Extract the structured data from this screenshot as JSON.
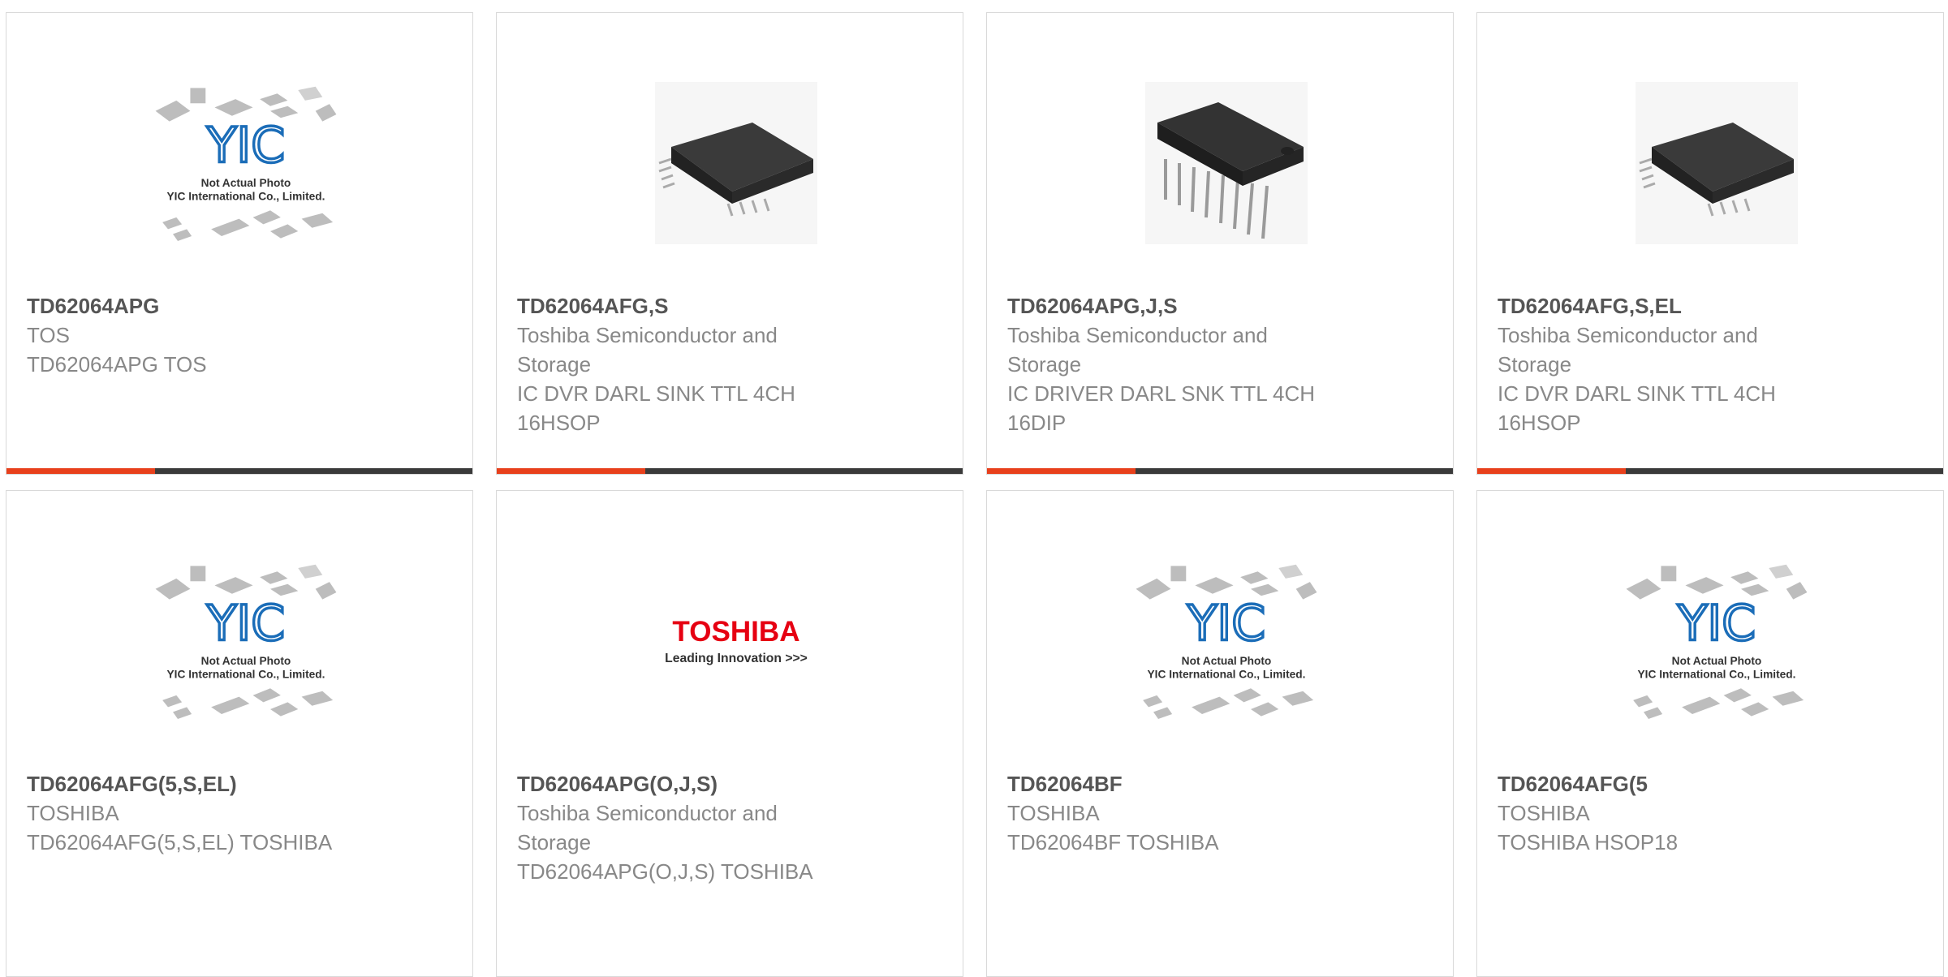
{
  "colors": {
    "accent": "#e8401c",
    "bar": "#3a3a3a",
    "yic_blue": "#1b6db8",
    "toshiba_red": "#e60012"
  },
  "placeholder": {
    "line1": "Not Actual Photo",
    "line2": "YIC International Co., Limited.",
    "logo_text": "YIC"
  },
  "toshiba_logo": {
    "brand": "TOSHIBA",
    "tagline": "Leading Innovation >>>"
  },
  "products": [
    {
      "pn": "TD62064APG",
      "lines": [
        "TOS",
        "TD62064APG TOS"
      ],
      "image": "placeholder-image"
    },
    {
      "pn": "TD62064AFG,S",
      "lines": [
        "Toshiba Semiconductor and",
        "Storage",
        "IC DVR DARL SINK TTL 4CH",
        "16HSOP"
      ],
      "image": "hsop-chip-image"
    },
    {
      "pn": "TD62064APG,J,S",
      "lines": [
        "Toshiba Semiconductor and",
        "Storage",
        "IC DRIVER DARL SNK TTL 4CH",
        "16DIP"
      ],
      "image": "dip-chip-image"
    },
    {
      "pn": "TD62064AFG,S,EL",
      "lines": [
        "Toshiba Semiconductor and",
        "Storage",
        "IC DVR DARL SINK TTL 4CH",
        "16HSOP"
      ],
      "image": "hsop-chip-image"
    },
    {
      "pn": "TD62064AFG(5,S,EL)",
      "lines": [
        "TOSHIBA",
        "TD62064AFG(5,S,EL) TOSHIBA"
      ],
      "image": "placeholder-image"
    },
    {
      "pn": "TD62064APG(O,J,S)",
      "lines": [
        "Toshiba Semiconductor and",
        "Storage",
        "TD62064APG(O,J,S) TOSHIBA"
      ],
      "image": "toshiba-logo-image"
    },
    {
      "pn": "TD62064BF",
      "lines": [
        "TOSHIBA",
        "TD62064BF TOSHIBA"
      ],
      "image": "placeholder-image"
    },
    {
      "pn": "TD62064AFG(5",
      "lines": [
        "TOSHIBA",
        "TOSHIBA HSOP18"
      ],
      "image": "placeholder-image"
    }
  ]
}
